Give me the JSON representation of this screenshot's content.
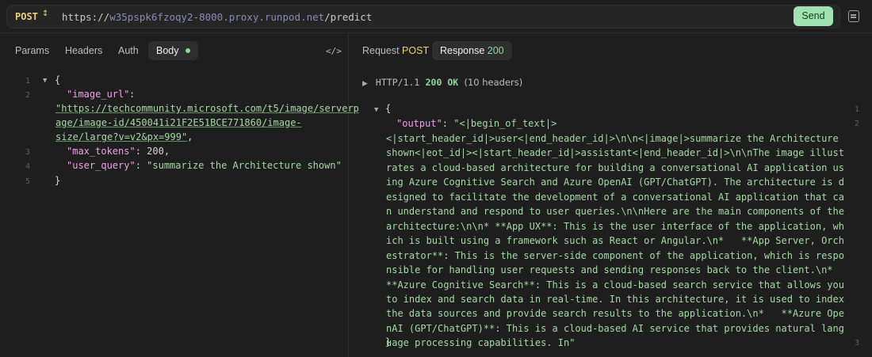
{
  "request": {
    "method": "POST",
    "url_scheme": "https://",
    "url_host": "w35pspk6fzoqy2-8000.proxy.runpod.net",
    "url_path": "/predict",
    "send_label": "Send"
  },
  "left_tabs": {
    "params": "Params",
    "headers": "Headers",
    "auth": "Auth",
    "body": "Body",
    "code_toggle": "</>"
  },
  "body_editor": {
    "line_numbers": [
      "1",
      "2",
      "3",
      "4",
      "5"
    ],
    "open_brace": "{",
    "close_brace": "}",
    "key_image_url": "\"image_url\"",
    "image_url_line1": "\"https://techcommunity.microsoft.com/t5/image/serverp",
    "image_url_line2": "age/image-id/450041i21F2E51BCE771860/image-",
    "image_url_line3": "size/large?v=v2&px=999\"",
    "key_max_tokens": "\"max_tokens\"",
    "max_tokens_value": "200",
    "key_user_query": "\"user_query\"",
    "user_query_value": "\"summarize the Architecture shown\""
  },
  "right_tabs": {
    "request_label": "Request",
    "request_method": "POST",
    "response_label": "Response",
    "response_status": "200"
  },
  "response": {
    "protocol": "HTTP/1.1",
    "status": "200 OK",
    "headers_count": "(10 headers)",
    "line_numbers": [
      "1",
      "2",
      "3"
    ],
    "open_brace": "{",
    "close_brace": "}",
    "key_output": "\"output\"",
    "output_first": "\"<|begin_of_text|>",
    "output_rest": "<|start_header_id|>user<|end_header_id|>\\n\\n<|image|>summarize the Architecture shown<|eot_id|><|start_header_id|>assistant<|end_header_id|>\\n\\nThe image illustrates a cloud-based architecture for building a conversational AI application using Azure Cognitive Search and Azure OpenAI (GPT/ChatGPT). The architecture is designed to facilitate the development of a conversational AI application that can understand and respond to user queries.\\n\\nHere are the main components of the architecture:\\n\\n* **App UX**: This is the user interface of the application, which is built using a framework such as React or Angular.\\n*   **App Server, Orchestrator**: This is the server-side component of the application, which is responsible for handling user requests and sending responses back to the client.\\n*   **Azure Cognitive Search**: This is a cloud-based search service that allows you to index and search data in real-time. In this architecture, it is used to index the data sources and provide search results to the application.\\n*   **Azure OpenAI (GPT/ChatGPT)**: This is a cloud-based AI service that provides natural language processing capabilities. In\""
  },
  "colors": {
    "background": "#1e1e1e",
    "accent_green": "#9fe3b0",
    "method_yellow": "#e8d27a",
    "key_pink": "#e7a6e0",
    "string_green": "#a8d7a8"
  }
}
